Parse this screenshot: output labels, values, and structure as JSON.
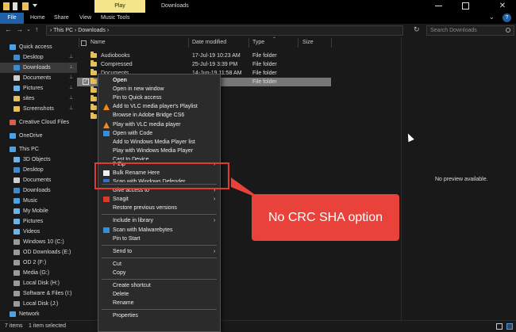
{
  "window": {
    "title": "Downloads",
    "contextual_tab": "Play",
    "close_glyph": "✕"
  },
  "ribbon": {
    "tabs": [
      "File",
      "Home",
      "Share",
      "View",
      "Music Tools"
    ],
    "collapse_glyph": "⌄",
    "help_glyph": "?"
  },
  "address": {
    "back": "←",
    "forward": "→",
    "recent": "⌄",
    "up": "↑",
    "path": "›  This PC  ›  Downloads  ›",
    "dropdown": "⌄",
    "refresh": "↻",
    "search_placeholder": "Search Downloads"
  },
  "sidebar": {
    "items": [
      {
        "label": "Quick access",
        "icon": "star-icon",
        "color": "#4aa3e8",
        "pinned": false,
        "selected": false
      },
      {
        "label": "Desktop",
        "icon": "desktop-icon",
        "color": "#3b8bd8",
        "pinned": true,
        "selected": false
      },
      {
        "label": "Downloads",
        "icon": "download-icon",
        "color": "#3b8bd8",
        "pinned": true,
        "selected": true
      },
      {
        "label": "Documents",
        "icon": "documents-icon",
        "color": "#cfcfcf",
        "pinned": true,
        "selected": false
      },
      {
        "label": "Pictures",
        "icon": "pictures-icon",
        "color": "#6bb3e8",
        "pinned": true,
        "selected": false
      },
      {
        "label": "sites",
        "icon": "folder-icon",
        "color": "#e8c05a",
        "pinned": true,
        "selected": false
      },
      {
        "label": "Screenshots",
        "icon": "folder-icon",
        "color": "#e8c05a",
        "pinned": true,
        "selected": false
      },
      {
        "label": "Creative Cloud Files",
        "icon": "creative-cloud-icon",
        "color": "#e05a4a",
        "pinned": false,
        "selected": false
      },
      {
        "label": "OneDrive",
        "icon": "onedrive-icon",
        "color": "#4aa3e8",
        "pinned": false,
        "selected": false
      },
      {
        "label": "This PC",
        "icon": "computer-icon",
        "color": "#4aa3e8",
        "pinned": false,
        "selected": false
      },
      {
        "label": "3D Objects",
        "icon": "3d-objects-icon",
        "color": "#6bb3e8",
        "pinned": false,
        "selected": false
      },
      {
        "label": "Desktop",
        "icon": "desktop-icon",
        "color": "#3b8bd8",
        "pinned": false,
        "selected": false
      },
      {
        "label": "Documents",
        "icon": "documents-icon",
        "color": "#cfcfcf",
        "pinned": false,
        "selected": false
      },
      {
        "label": "Downloads",
        "icon": "download-icon",
        "color": "#3b8bd8",
        "pinned": false,
        "selected": false
      },
      {
        "label": "Music",
        "icon": "music-icon",
        "color": "#4aa3e8",
        "pinned": false,
        "selected": false
      },
      {
        "label": "My Mobile",
        "icon": "mobile-icon",
        "color": "#6bb3e8",
        "pinned": false,
        "selected": false
      },
      {
        "label": "Pictures",
        "icon": "pictures-icon",
        "color": "#6bb3e8",
        "pinned": false,
        "selected": false
      },
      {
        "label": "Videos",
        "icon": "videos-icon",
        "color": "#6bb3e8",
        "pinned": false,
        "selected": false
      },
      {
        "label": "Windows 10 (C:)",
        "icon": "drive-icon",
        "color": "#9a9a9a",
        "pinned": false,
        "selected": false
      },
      {
        "label": "OD Downloads  (E:)",
        "icon": "drive-icon",
        "color": "#9a9a9a",
        "pinned": false,
        "selected": false
      },
      {
        "label": "OD 2 (F:)",
        "icon": "drive-icon",
        "color": "#9a9a9a",
        "pinned": false,
        "selected": false
      },
      {
        "label": "Media (G:)",
        "icon": "drive-icon",
        "color": "#9a9a9a",
        "pinned": false,
        "selected": false
      },
      {
        "label": "Local Disk (H:)",
        "icon": "drive-icon",
        "color": "#9a9a9a",
        "pinned": false,
        "selected": false
      },
      {
        "label": "Software & Files (I:)",
        "icon": "drive-icon",
        "color": "#9a9a9a",
        "pinned": false,
        "selected": false
      },
      {
        "label": "Local Disk (J:)",
        "icon": "drive-icon",
        "color": "#9a9a9a",
        "pinned": false,
        "selected": false
      },
      {
        "label": "Network",
        "icon": "network-icon",
        "color": "#4aa3e8",
        "pinned": false,
        "selected": false
      }
    ],
    "pin_glyph": "📌"
  },
  "files": {
    "columns": [
      "Name",
      "Date modified",
      "Type",
      "Size"
    ],
    "rows": [
      {
        "name": "Audiobooks",
        "date": "17-Jul-19 10:23 AM",
        "type": "File folder",
        "selected": false
      },
      {
        "name": "Compressed",
        "date": "25-Jul-19 3:39 PM",
        "type": "File folder",
        "selected": false
      },
      {
        "name": "Documents",
        "date": "14-Jun-19 11:58 AM",
        "type": "File folder",
        "selected": false
      },
      {
        "name": "",
        "date": "5 PM",
        "type": "File folder",
        "selected": true
      },
      {
        "name": "",
        "date": "",
        "type": "",
        "selected": false
      },
      {
        "name": "",
        "date": "",
        "type": "",
        "selected": false
      },
      {
        "name": "",
        "date": "",
        "type": "",
        "selected": false
      },
      {
        "name": "",
        "date": "",
        "type": "",
        "selected": false
      }
    ],
    "check_glyph": "✓"
  },
  "preview": {
    "text": "No preview available."
  },
  "status": {
    "count": "7 items",
    "selected": "1 item selected"
  },
  "context_menu": {
    "items": [
      {
        "type": "item",
        "label": "Open",
        "bold": true,
        "icon": "",
        "arrow": false
      },
      {
        "type": "item",
        "label": "Open in new window",
        "icon": "",
        "arrow": false
      },
      {
        "type": "item",
        "label": "Pin to Quick access",
        "icon": "",
        "arrow": false
      },
      {
        "type": "item",
        "label": "Add to VLC media player's Playlist",
        "icon": "vlc-icon",
        "arrow": false
      },
      {
        "type": "item",
        "label": "Browse in Adobe Bridge CS6",
        "icon": "",
        "arrow": false
      },
      {
        "type": "item",
        "label": "Play with VLC media player",
        "icon": "vlc-icon",
        "arrow": false
      },
      {
        "type": "item",
        "label": "Open with Code",
        "icon": "vscode-icon",
        "arrow": false
      },
      {
        "type": "item",
        "label": "Add to Windows Media Player list",
        "icon": "",
        "arrow": false
      },
      {
        "type": "item",
        "label": "Play with Windows Media Player",
        "icon": "",
        "arrow": false
      },
      {
        "type": "partial",
        "label": "Cast to Device",
        "icon": "",
        "arrow": false
      },
      {
        "type": "item",
        "label": "7-Zip",
        "icon": "",
        "arrow": true
      },
      {
        "type": "item",
        "label": "Bulk Rename Here",
        "icon": "bulk-rename-icon",
        "arrow": false
      },
      {
        "type": "partial",
        "label": "Scan with Windows Defender...",
        "icon": "defender-icon",
        "arrow": false
      },
      {
        "type": "sep"
      },
      {
        "type": "item",
        "label": "Give access to",
        "icon": "",
        "arrow": true
      },
      {
        "type": "item",
        "label": "Snagit",
        "icon": "snagit-icon",
        "arrow": true
      },
      {
        "type": "item",
        "label": "Restore previous versions",
        "icon": "",
        "arrow": false
      },
      {
        "type": "sep"
      },
      {
        "type": "item",
        "label": "Include in library",
        "icon": "",
        "arrow": true
      },
      {
        "type": "item",
        "label": "Scan with Malwarebytes",
        "icon": "malwarebytes-icon",
        "arrow": false
      },
      {
        "type": "item",
        "label": "Pin to Start",
        "icon": "",
        "arrow": false
      },
      {
        "type": "sep"
      },
      {
        "type": "item",
        "label": "Send to",
        "icon": "",
        "arrow": true
      },
      {
        "type": "sep"
      },
      {
        "type": "item",
        "label": "Cut",
        "icon": "",
        "arrow": false
      },
      {
        "type": "item",
        "label": "Copy",
        "icon": "",
        "arrow": false
      },
      {
        "type": "sep"
      },
      {
        "type": "item",
        "label": "Create shortcut",
        "icon": "",
        "arrow": false
      },
      {
        "type": "item",
        "label": "Delete",
        "icon": "",
        "arrow": false
      },
      {
        "type": "item",
        "label": "Rename",
        "icon": "",
        "arrow": false
      },
      {
        "type": "sep"
      },
      {
        "type": "item",
        "label": "Properties",
        "icon": "",
        "arrow": false
      }
    ],
    "arrow_glyph": "›"
  },
  "annotation": {
    "callout_text": "No CRC SHA option",
    "color": "#e23a31"
  }
}
